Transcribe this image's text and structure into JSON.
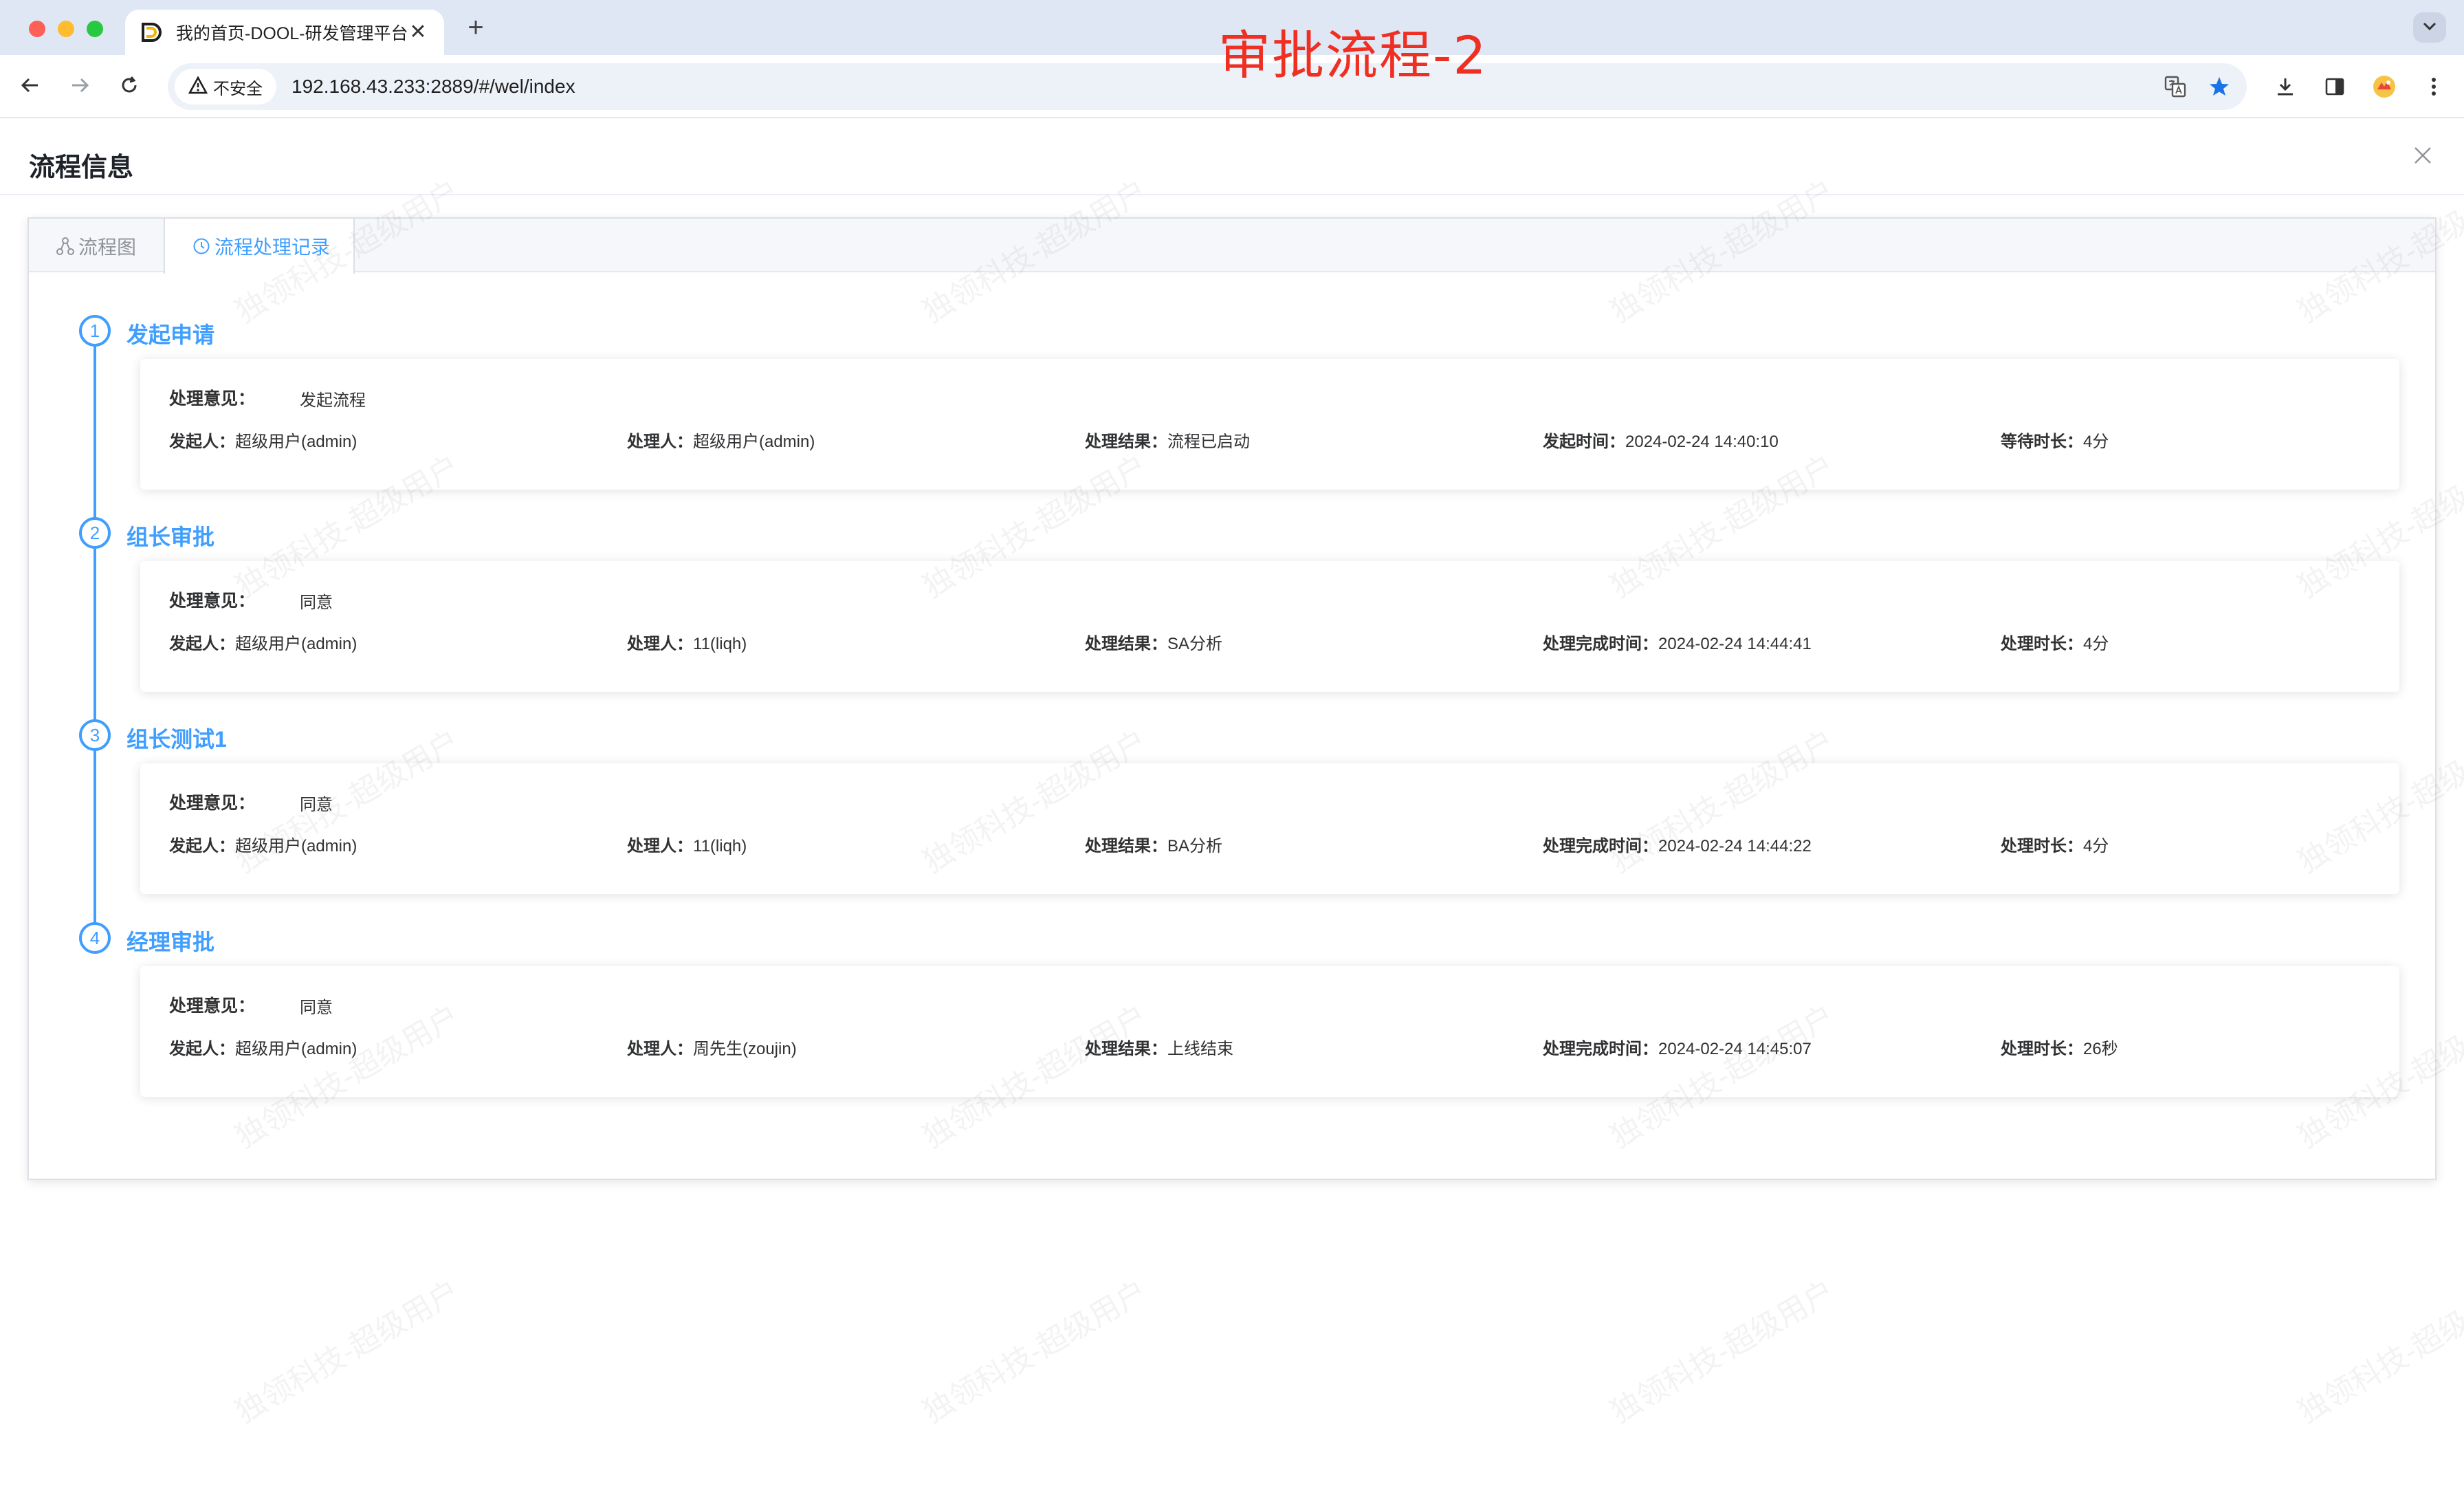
{
  "browser": {
    "tab_title": "我的首页-DOOL-研发管理平台",
    "tab_close": "✕",
    "new_tab": "+",
    "security_label": "不安全",
    "url": "192.168.43.233:2889/#/wel/index"
  },
  "overlay_title": "审批流程-2",
  "dialog": {
    "title": "流程信息",
    "tabs": [
      {
        "label": "流程图"
      },
      {
        "label": "流程处理记录"
      }
    ]
  },
  "steps": [
    {
      "number": "1",
      "title": "发起申请",
      "opinion_label": "处理意见：",
      "opinion": "发起流程",
      "fields": [
        {
          "label": "发起人：",
          "value": "超级用户(admin)"
        },
        {
          "label": "处理人：",
          "value": "超级用户(admin)"
        },
        {
          "label": "处理结果：",
          "value": "流程已启动"
        },
        {
          "label": "发起时间：",
          "value": "2024-02-24 14:40:10"
        },
        {
          "label": "等待时长：",
          "value": "4分"
        }
      ]
    },
    {
      "number": "2",
      "title": "组长审批",
      "opinion_label": "处理意见：",
      "opinion": "同意",
      "fields": [
        {
          "label": "发起人：",
          "value": "超级用户(admin)"
        },
        {
          "label": "处理人：",
          "value": "11(liqh)"
        },
        {
          "label": "处理结果：",
          "value": "SA分析"
        },
        {
          "label": "处理完成时间：",
          "value": "2024-02-24 14:44:41"
        },
        {
          "label": "处理时长：",
          "value": "4分"
        }
      ]
    },
    {
      "number": "3",
      "title": "组长测试1",
      "opinion_label": "处理意见：",
      "opinion": "同意",
      "fields": [
        {
          "label": "发起人：",
          "value": "超级用户(admin)"
        },
        {
          "label": "处理人：",
          "value": "11(liqh)"
        },
        {
          "label": "处理结果：",
          "value": "BA分析"
        },
        {
          "label": "处理完成时间：",
          "value": "2024-02-24 14:44:22"
        },
        {
          "label": "处理时长：",
          "value": "4分"
        }
      ]
    },
    {
      "number": "4",
      "title": "经理审批",
      "opinion_label": "处理意见：",
      "opinion": "同意",
      "fields": [
        {
          "label": "发起人：",
          "value": "超级用户(admin)"
        },
        {
          "label": "处理人：",
          "value": "周先生(zoujin)"
        },
        {
          "label": "处理结果：",
          "value": "上线结束"
        },
        {
          "label": "处理完成时间：",
          "value": "2024-02-24 14:45:07"
        },
        {
          "label": "处理时长：",
          "value": "26秒"
        }
      ]
    }
  ],
  "watermark_text": "独领科技-超级用户",
  "colors": {
    "accent": "#409eff",
    "overlay_red": "#ee2f22",
    "bookmark_star": "#1a73e8"
  }
}
